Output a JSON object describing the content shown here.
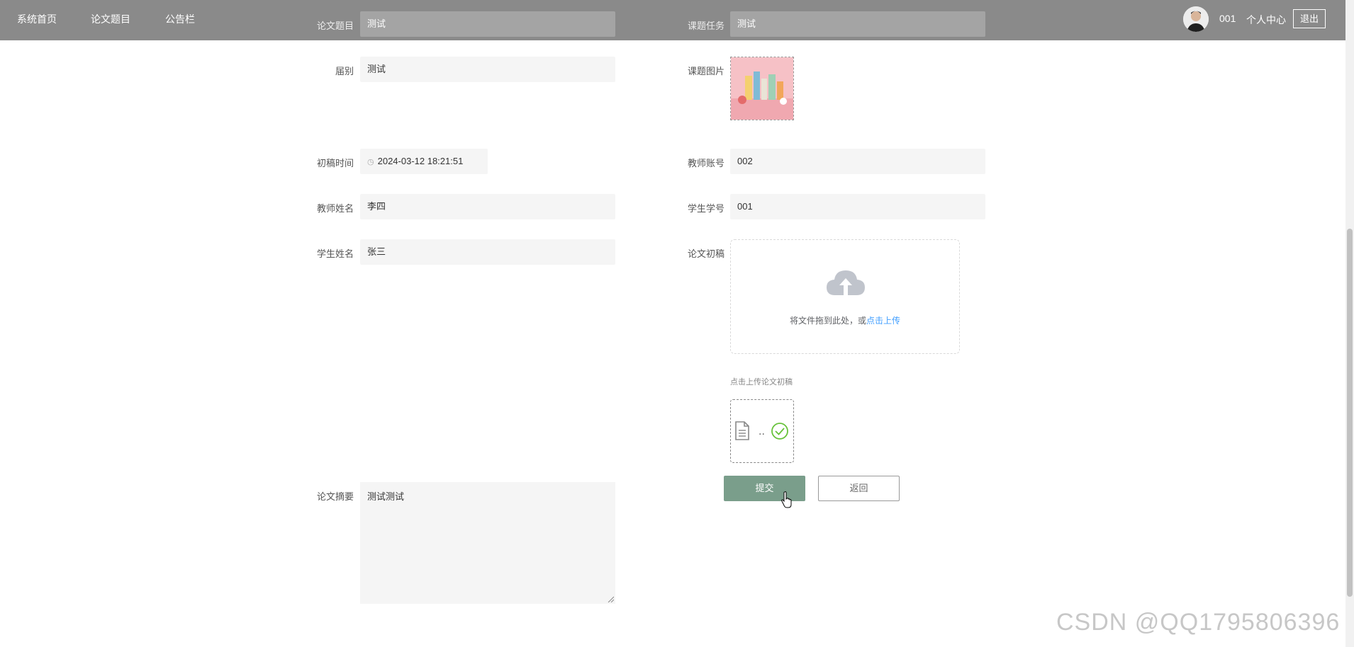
{
  "nav": {
    "items": [
      {
        "label": "系统首页"
      },
      {
        "label": "论文题目"
      },
      {
        "label": "公告栏"
      }
    ],
    "user_id": "001",
    "personal_center": "个人中心",
    "logout": "退出"
  },
  "form": {
    "topic": {
      "label": "论文题目",
      "value": "测试"
    },
    "task": {
      "label": "课题任务",
      "value": "测试"
    },
    "session": {
      "label": "届别",
      "value": "测试"
    },
    "image": {
      "label": "课题图片"
    },
    "draft_time": {
      "label": "初稿时间",
      "value": "2024-03-12 18:21:51"
    },
    "teacher_account": {
      "label": "教师账号",
      "value": "002"
    },
    "teacher_name": {
      "label": "教师姓名",
      "value": "李四"
    },
    "student_id": {
      "label": "学生学号",
      "value": "001"
    },
    "student_name": {
      "label": "学生姓名",
      "value": "张三"
    },
    "draft": {
      "label": "论文初稿"
    },
    "abstract": {
      "label": "论文摘要",
      "value": "测试测试"
    }
  },
  "upload": {
    "text": "将文件拖到此处，或",
    "link": "点击上传",
    "tip": "点击上传论文初稿",
    "file_name": ".."
  },
  "buttons": {
    "submit": "提交",
    "back": "返回"
  },
  "watermark": "CSDN @QQ1795806396",
  "icons": [
    "avatar",
    "clock-icon",
    "upload-cloud-icon",
    "document-icon",
    "check-circle-icon",
    "hand-cursor-icon"
  ]
}
